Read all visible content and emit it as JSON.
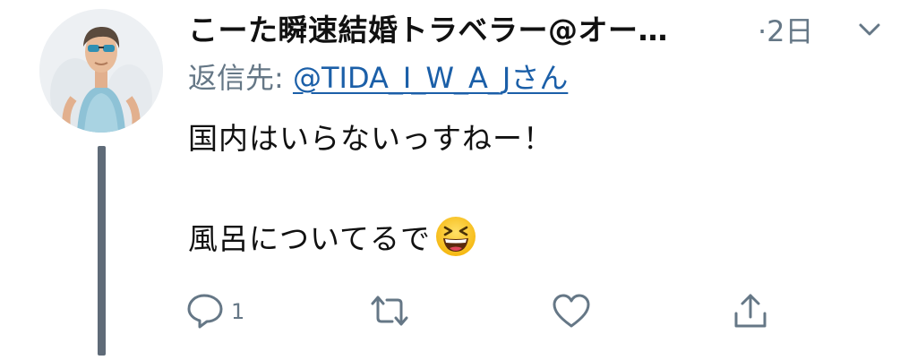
{
  "tweet": {
    "display_name": "こーた瞬速結婚トラベラー@オー…",
    "time": "·2日",
    "reply_to_label": "返信先: ",
    "reply_to_handle": "@TIDA_I_W_A_Jさん",
    "body_line1": "国内はいらないっすねー！",
    "body_line2": "風呂についてるで",
    "emoji_name": "grinning-squinting-face-emoji",
    "reply_count": "1"
  },
  "colors": {
    "text": "#111111",
    "secondary": "#657786",
    "link": "#1b5fa8",
    "thread_line": "#5f6b78"
  }
}
